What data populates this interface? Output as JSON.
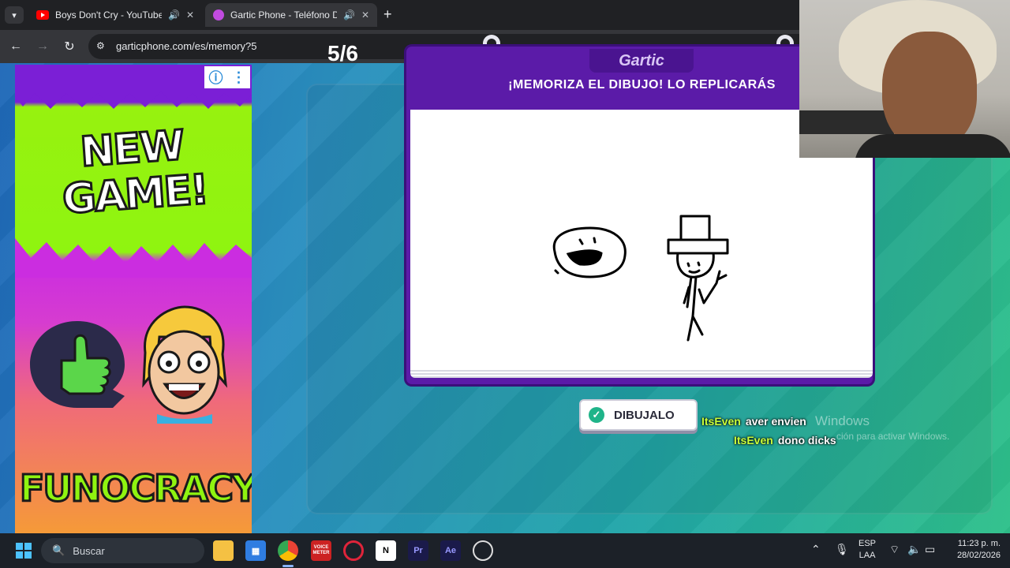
{
  "browser": {
    "tabs": [
      {
        "title": "Boys Don't Cry - YouTube",
        "active": false
      },
      {
        "title": "Gartic Phone - Teléfono De",
        "active": true
      }
    ],
    "url": "garticphone.com/es/memory?5"
  },
  "ad": {
    "headline": "NEW GAME!",
    "brand": "FUNOCRACY"
  },
  "game": {
    "round": "5/6",
    "logo": "Gartic",
    "instruction": "¡MEMORIZA EL DIBUJO! LO REPLICARÁS",
    "draw_button": "DIBUJALO"
  },
  "chat": [
    {
      "user": "ItsEven",
      "message": "aver envien"
    },
    {
      "user": "ItsEven",
      "message": "dono dicks"
    }
  ],
  "watermark": {
    "line1": "Windows",
    "line2": "ción para activar Windows."
  },
  "taskbar": {
    "search_placeholder": "Buscar",
    "language": "ESP",
    "layout": "LAA",
    "time": "11:23 p. m.",
    "date": "28/02/2026",
    "voicemeeter_label": "VOICE METER"
  },
  "colors": {
    "accent_purple": "#5b1ba8",
    "chat_user": "#c9ff3a",
    "button_check": "#1fb489"
  }
}
